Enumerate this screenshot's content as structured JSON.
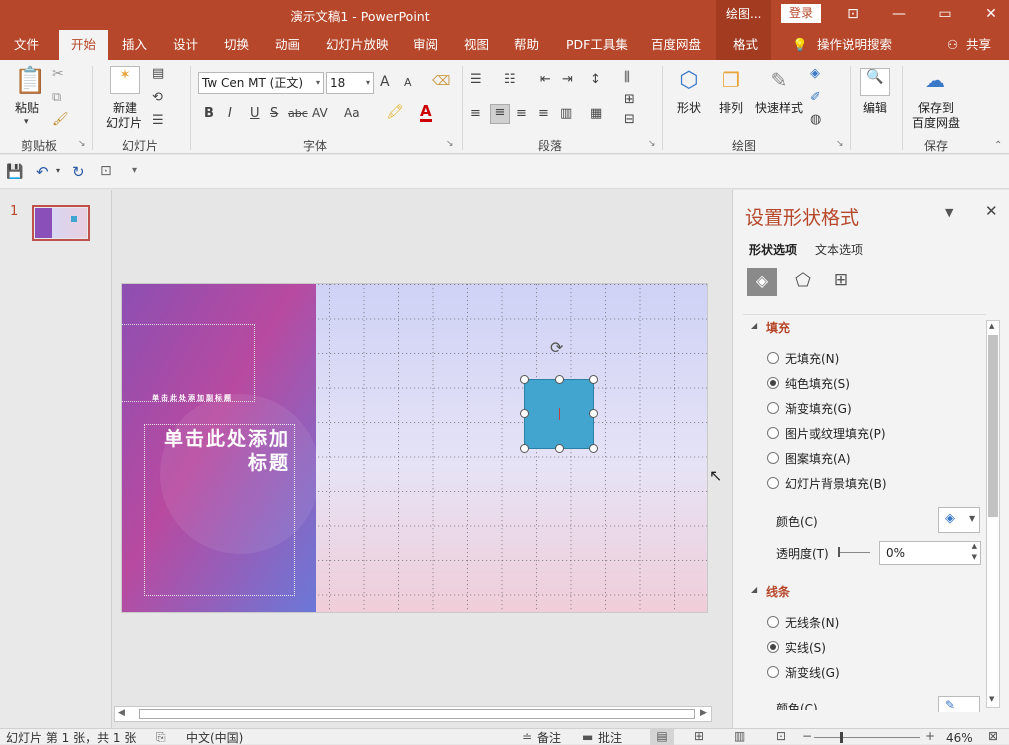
{
  "titlebar": {
    "title": "演示文稿1  -  PowerPoint",
    "context_tab": "绘图...",
    "login": "登录",
    "minimize": "—",
    "restore": "▭",
    "close": "✕",
    "ribbon_options": "⊡"
  },
  "tabs": [
    {
      "label": "文件"
    },
    {
      "label": "开始"
    },
    {
      "label": "插入"
    },
    {
      "label": "设计"
    },
    {
      "label": "切换"
    },
    {
      "label": "动画"
    },
    {
      "label": "幻灯片放映"
    },
    {
      "label": "审阅"
    },
    {
      "label": "视图"
    },
    {
      "label": "帮助"
    },
    {
      "label": "PDF工具集"
    },
    {
      "label": "百度网盘"
    },
    {
      "label": "格式"
    }
  ],
  "tell_me": "操作说明搜索",
  "share": "共享",
  "ribbon": {
    "clipboard": {
      "paste": "粘贴",
      "group": "剪贴板"
    },
    "slides": {
      "new_slide_1": "新建",
      "new_slide_2": "幻灯片",
      "group": "幻灯片"
    },
    "font": {
      "font_name": "Tw Cen MT (正文)",
      "font_size": "18",
      "bold": "B",
      "italic": "I",
      "underline": "U",
      "strike": "S",
      "shadow": "abc",
      "spacing": "AV",
      "case": "Aa",
      "grow": "A",
      "shrink": "A",
      "group": "字体"
    },
    "paragraph": {
      "group": "段落"
    },
    "drawing": {
      "shapes": "形状",
      "arrange": "排列",
      "quick_styles": "快速样式",
      "group": "绘图"
    },
    "editing": {
      "edit": "编辑"
    },
    "save": {
      "save_1": "保存到",
      "save_2": "百度网盘",
      "group": "保存"
    }
  },
  "thumbs": {
    "slide_number": "1"
  },
  "slide": {
    "subtitle": "单击此处添加副标题",
    "title_1": "单击此处添加",
    "title_2": "标题"
  },
  "pane": {
    "title": "设置形状格式",
    "tab_shape": "形状选项",
    "tab_text": "文本选项",
    "fill_section": "填充",
    "fill_options": [
      {
        "label": "无填充(N)",
        "selected": false
      },
      {
        "label": "纯色填充(S)",
        "selected": true
      },
      {
        "label": "渐变填充(G)",
        "selected": false
      },
      {
        "label": "图片或纹理填充(P)",
        "selected": false
      },
      {
        "label": "图案填充(A)",
        "selected": false
      },
      {
        "label": "幻灯片背景填充(B)",
        "selected": false
      }
    ],
    "color_label": "颜色(C)",
    "transparency_label": "透明度(T)",
    "transparency_value": "0%",
    "line_section": "线条",
    "line_options": [
      {
        "label": "无线条(N)",
        "selected": false
      },
      {
        "label": "实线(S)",
        "selected": true
      },
      {
        "label": "渐变线(G)",
        "selected": false
      }
    ],
    "line_color_label": "颜色(C)"
  },
  "status": {
    "slide_info": "幻灯片 第 1 张，共 1 张",
    "language": "中文(中国)",
    "notes": "备注",
    "comments": "批注",
    "zoom": "46%"
  },
  "colors": {
    "accent": "#b7472a",
    "shape_fill": "#42a5cf"
  }
}
